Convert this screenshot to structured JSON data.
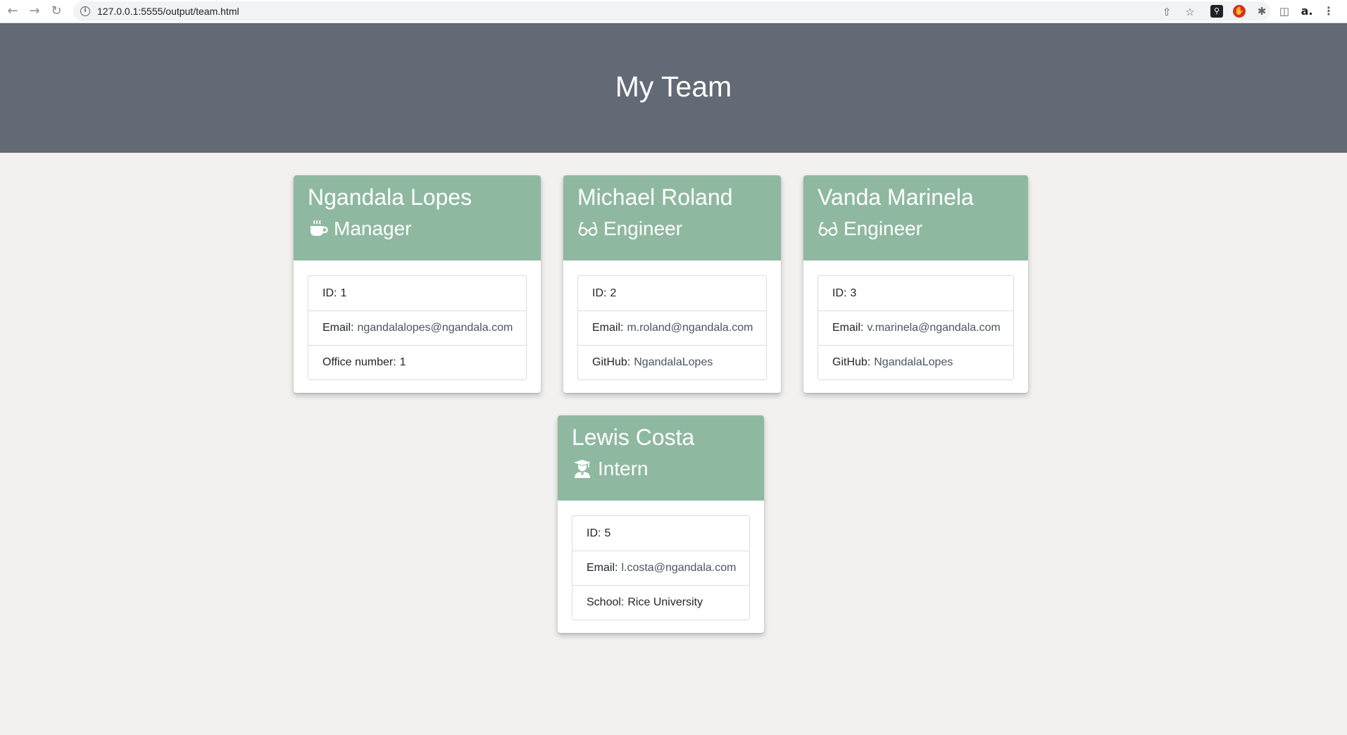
{
  "browser": {
    "url": "127.0.0.1:5555/output/team.html"
  },
  "header": {
    "title": "My Team"
  },
  "team": [
    {
      "name": "Ngandala Lopes",
      "role": "Manager",
      "role_icon": "coffee-icon",
      "id_label": "ID:",
      "id": "1",
      "email_label": "Email:",
      "email": "ngandalalopes@ngandala.com",
      "extra_label": "Office number:",
      "extra_value": "1"
    },
    {
      "name": "Michael Roland",
      "role": "Engineer",
      "role_icon": "glasses-icon",
      "id_label": "ID:",
      "id": "2",
      "email_label": "Email:",
      "email": "m.roland@ngandala.com",
      "extra_label": "GitHub:",
      "extra_value": "NgandalaLopes"
    },
    {
      "name": "Vanda Marinela",
      "role": "Engineer",
      "role_icon": "glasses-icon",
      "id_label": "ID:",
      "id": "3",
      "email_label": "Email:",
      "email": "v.marinela@ngandala.com",
      "extra_label": "GitHub:",
      "extra_value": "NgandalaLopes"
    },
    {
      "name": "Lewis Costa",
      "role": "Intern",
      "role_icon": "graduate-icon",
      "id_label": "ID:",
      "id": "5",
      "email_label": "Email:",
      "email": "l.costa@ngandala.com",
      "extra_label": "School:",
      "extra_value": "Rice University"
    }
  ],
  "colors": {
    "header_bg": "#636a76",
    "card_header_bg": "#8fb8a1",
    "page_bg": "#f2f1ef"
  }
}
